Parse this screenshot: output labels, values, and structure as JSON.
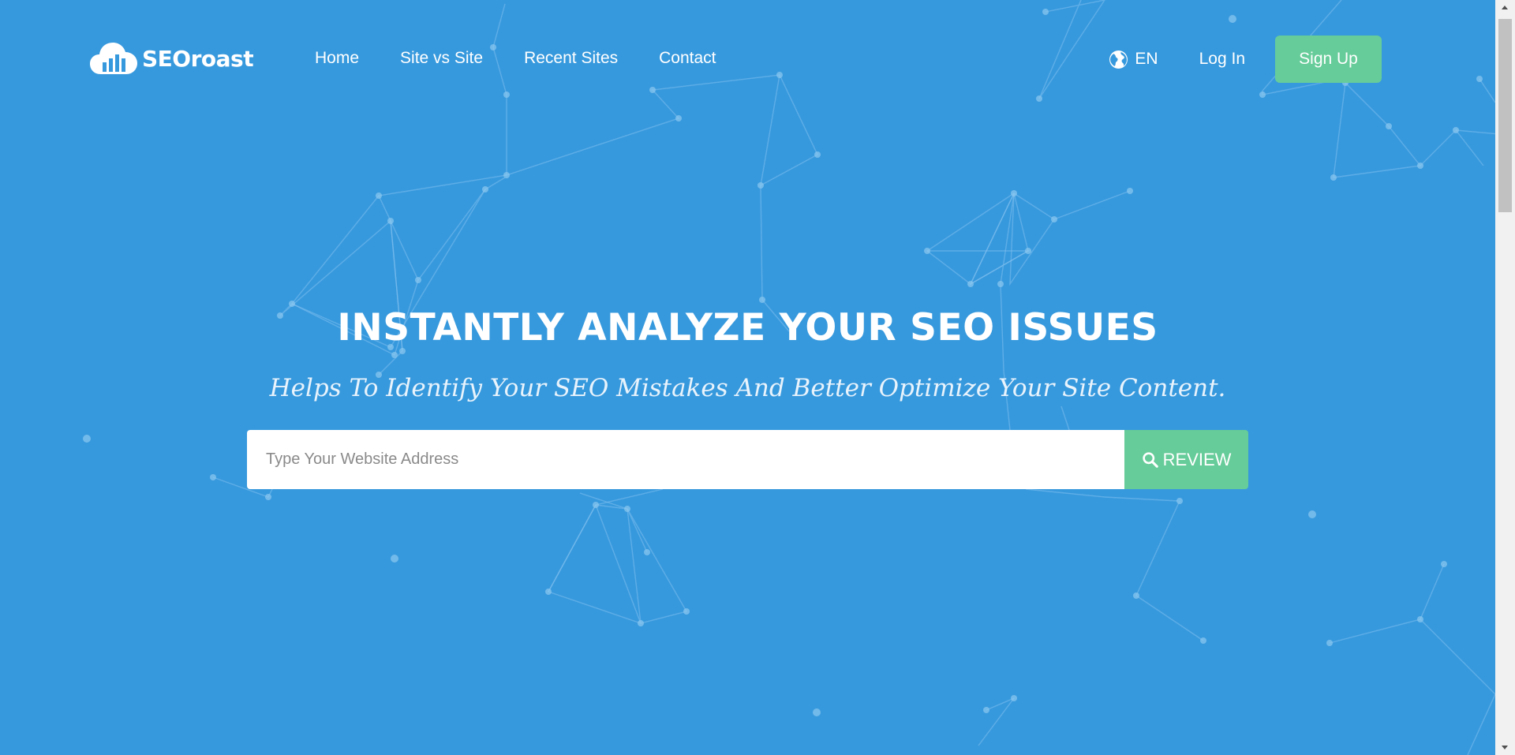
{
  "brand": {
    "name": "SEOroast"
  },
  "nav": {
    "items": [
      {
        "label": "Home"
      },
      {
        "label": "Site vs Site"
      },
      {
        "label": "Recent Sites"
      },
      {
        "label": "Contact"
      }
    ]
  },
  "header_right": {
    "language": "EN",
    "login_label": "Log In",
    "signup_label": "Sign Up"
  },
  "hero": {
    "title": "INSTANTLY ANALYZE YOUR SEO ISSUES",
    "subtitle": "Helps To Identify Your SEO Mistakes And Better Optimize Your Site Content.",
    "search_placeholder": "Type Your Website Address",
    "search_value": "",
    "review_label": "REVIEW"
  },
  "colors": {
    "background": "#3799dd",
    "accent_green": "#66cc99",
    "text": "#ffffff"
  }
}
